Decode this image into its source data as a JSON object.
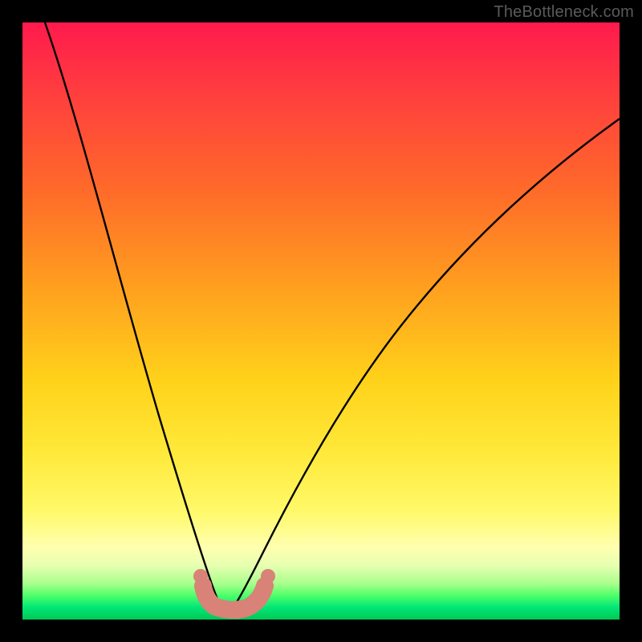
{
  "attribution": "TheBottleneck.com",
  "colors": {
    "frame": "#000000",
    "gradient_top": "#ff1a4d",
    "gradient_bottom": "#00c853",
    "curve": "#000000",
    "marker": "#d98278"
  },
  "chart_data": {
    "type": "line",
    "title": "",
    "xlabel": "",
    "ylabel": "",
    "xlim": [
      0,
      100
    ],
    "ylim": [
      0,
      100
    ],
    "series": [
      {
        "name": "left-branch",
        "x": [
          4,
          8,
          12,
          16,
          20,
          24,
          26,
          28,
          30,
          31.5,
          33
        ],
        "y": [
          100,
          82,
          66,
          50,
          35,
          20,
          13,
          7,
          3,
          1,
          0
        ]
      },
      {
        "name": "right-branch",
        "x": [
          33,
          36,
          40,
          45,
          52,
          60,
          70,
          80,
          90,
          100
        ],
        "y": [
          0,
          4,
          12,
          23,
          37,
          50,
          62,
          71,
          78,
          84
        ]
      }
    ],
    "markers": {
      "name": "bottom-dots",
      "points": [
        {
          "x": 29.5,
          "y": 6.5
        },
        {
          "x": 30.0,
          "y": 4.0
        },
        {
          "x": 30.7,
          "y": 2.7
        },
        {
          "x": 33.0,
          "y": 1.2
        },
        {
          "x": 35.5,
          "y": 1.2
        },
        {
          "x": 38.0,
          "y": 1.2
        },
        {
          "x": 39.5,
          "y": 2.7
        },
        {
          "x": 40.3,
          "y": 4.0
        },
        {
          "x": 41.0,
          "y": 6.5
        }
      ]
    }
  }
}
